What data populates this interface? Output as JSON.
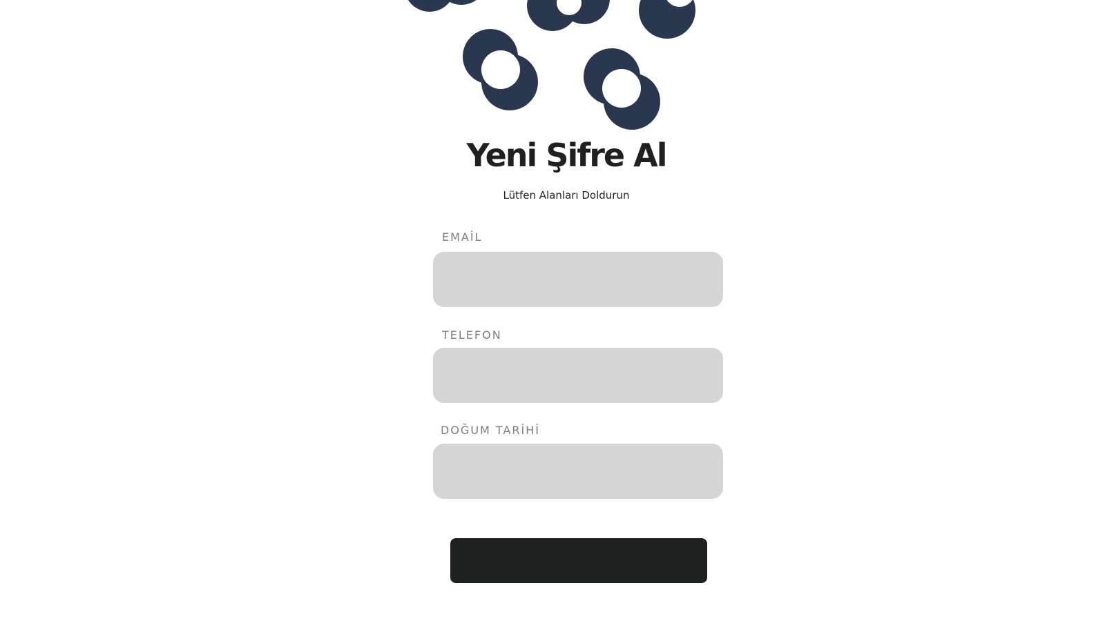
{
  "header": {
    "logo_icon": "overlapping-circles-logo",
    "title": "Yeni Şifre Al",
    "subtitle": "Lütfen Alanları Doldurun"
  },
  "form": {
    "fields": [
      {
        "label": "EMAİL",
        "value": ""
      },
      {
        "label": "TELEFON",
        "value": ""
      },
      {
        "label": "DOĞUM TARİHİ",
        "value": ""
      }
    ],
    "submit_label": ""
  },
  "colors": {
    "logo": "#2b364f",
    "heading_text": "#1f2120",
    "label_text": "#7d7d7d",
    "input_background": "#d5d5d5",
    "button_background": "#1f2120",
    "page_background": "#ffffff"
  }
}
